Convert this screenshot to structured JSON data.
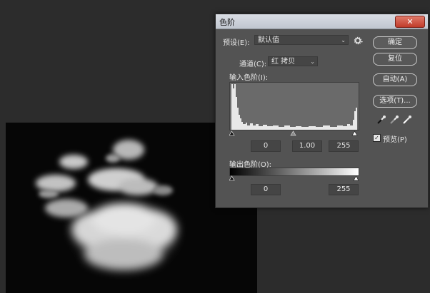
{
  "dialog": {
    "title": "色阶",
    "close_label": "✕",
    "preset_label": "预设(E):",
    "preset_value": "默认值",
    "channel_label": "通道(C):",
    "channel_value": "红 拷贝",
    "input_levels_label": "输入色阶(I):",
    "output_levels_label": "输出色阶(O):",
    "input_black": "0",
    "input_gamma": "1.00",
    "input_white": "255",
    "output_black": "0",
    "output_white": "255",
    "preview_label": "预览(P)",
    "preview_checked": true
  },
  "buttons": {
    "ok": "确定",
    "reset": "复位",
    "auto": "自动(A)",
    "options": "选项(T)..."
  },
  "icons": {
    "preset_menu": "gear-icon",
    "black_eyedropper": "eyedropper-black-icon",
    "gray_eyedropper": "eyedropper-gray-icon",
    "white_eyedropper": "eyedropper-white-icon"
  },
  "colors": {
    "dialog_bg": "#535353",
    "titlebar": "#c9ced6",
    "close": "#c8483a"
  }
}
